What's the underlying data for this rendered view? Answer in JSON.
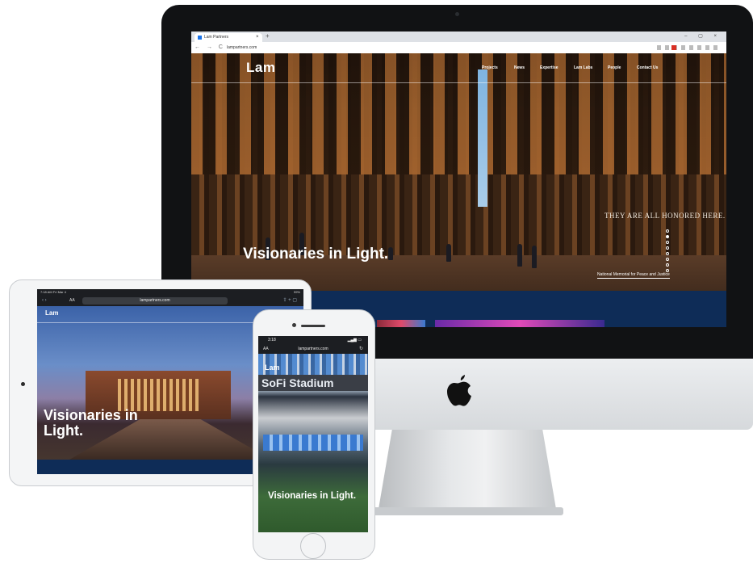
{
  "desktop": {
    "browser": {
      "tab_title": "Lam Partners",
      "tab_close": "×",
      "new_tab": "+",
      "window_controls": "– ▢ ×",
      "nav_buttons": "← → C",
      "url": "lampartners.com"
    },
    "site": {
      "logo": "Lam",
      "nav": [
        "Projects",
        "News",
        "Expertise",
        "Lam Labs",
        "People",
        "Contact Us"
      ],
      "headline": "Visionaries in Light.",
      "wall_text": "THEY ARE ALL HONORED HERE.",
      "caption": "National Memorial for Peace and Justice",
      "slides_total": 8,
      "slide_active": 2
    }
  },
  "tablet": {
    "status_left": "7:18 AM  Fri Mar 4",
    "status_right": "99%",
    "text_size": "AA",
    "url": "lampartners.com",
    "site": {
      "logo": "Lam",
      "headline": "Visionaries in Light."
    }
  },
  "phone": {
    "status_time": "3:18",
    "text_size": "AA",
    "url": "lampartners.com",
    "site": {
      "logo": "Lam",
      "stadium_sign": "SoFi Stadium",
      "headline": "Visionaries in Light."
    }
  },
  "colors": {
    "brand_navy": "#0e2c57",
    "imac_bezel": "#111214",
    "device_body": "#f4f5f6"
  }
}
